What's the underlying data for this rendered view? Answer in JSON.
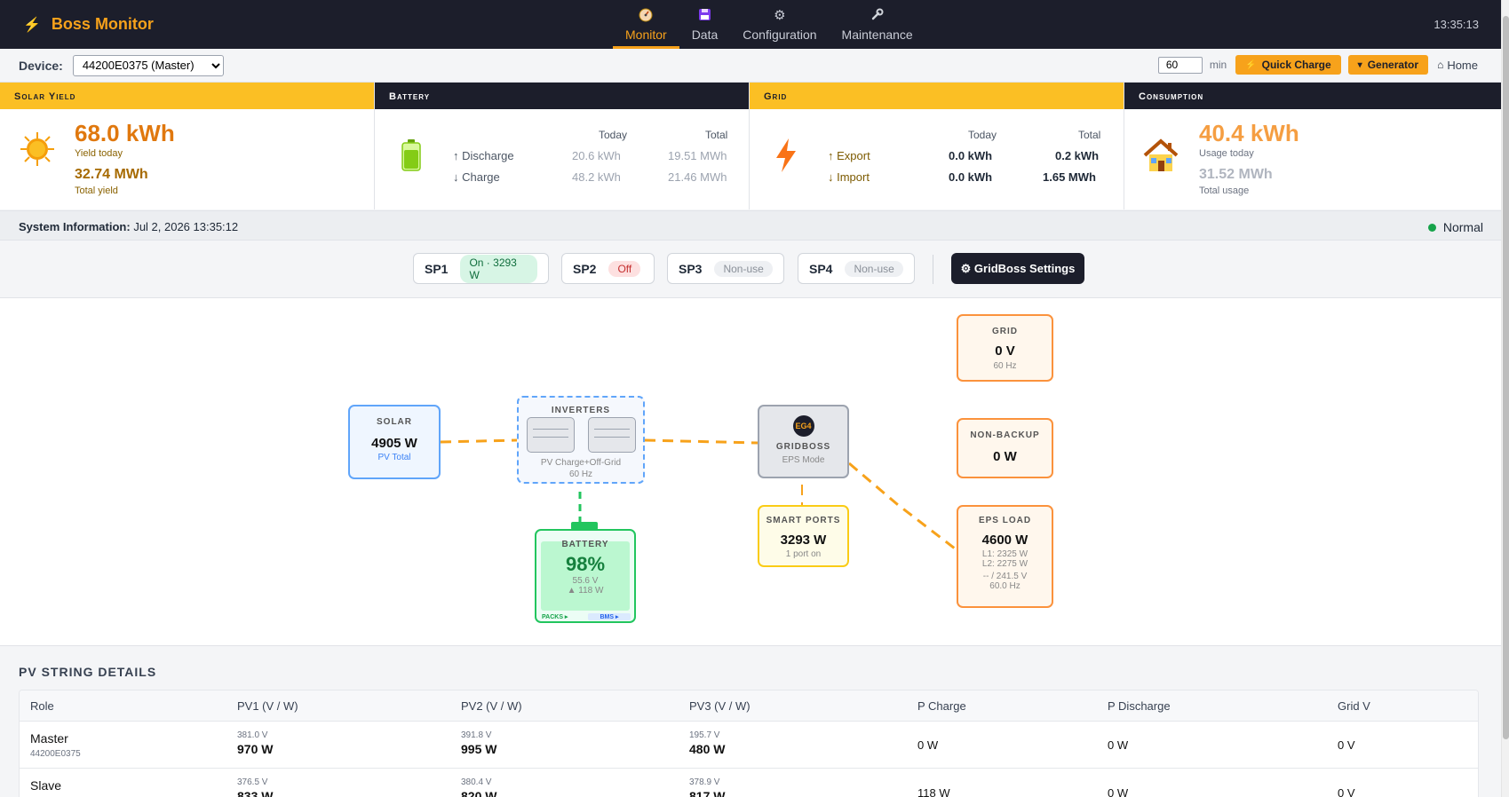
{
  "app": {
    "title": "Boss Monitor",
    "clock": "13:35:13"
  },
  "nav": [
    {
      "label": "Monitor",
      "icon": "gauge-icon"
    },
    {
      "label": "Data",
      "icon": "floppy-icon"
    },
    {
      "label": "Configuration",
      "icon": "gear-icon"
    },
    {
      "label": "Maintenance",
      "icon": "wrench-icon"
    }
  ],
  "device": {
    "label": "Device:",
    "selected": "44200E0375 (Master)",
    "minutes": "60",
    "min_unit": "min",
    "quick_charge": "Quick Charge",
    "generator": "Generator",
    "home": "Home"
  },
  "cards": {
    "solar": {
      "title": "Solar Yield",
      "today": "68.0 kWh",
      "today_label": "Yield today",
      "total": "32.74 MWh",
      "total_label": "Total yield"
    },
    "battery": {
      "title": "Battery",
      "col_today": "Today",
      "col_total": "Total",
      "rows": [
        {
          "label": "↑ Discharge",
          "today": "20.6 kWh",
          "total": "19.51 MWh"
        },
        {
          "label": "↓ Charge",
          "today": "48.2 kWh",
          "total": "21.46 MWh"
        }
      ]
    },
    "grid": {
      "title": "Grid",
      "col_today": "Today",
      "col_total": "Total",
      "rows": [
        {
          "label": "↑ Export",
          "today": "0.0 kWh",
          "total": "0.2 kWh"
        },
        {
          "label": "↓ Import",
          "today": "0.0 kWh",
          "total": "1.65 MWh"
        }
      ]
    },
    "consumption": {
      "title": "Consumption",
      "today": "40.4 kWh",
      "today_label": "Usage today",
      "total": "31.52 MWh",
      "total_label": "Total usage"
    }
  },
  "system": {
    "label": "System Information:",
    "datetime": "Jul 2, 2026 13:35:12",
    "status": "Normal"
  },
  "smart_ports": [
    {
      "name": "SP1",
      "state": "On · 3293 W"
    },
    {
      "name": "SP2",
      "state": "Off"
    },
    {
      "name": "SP3",
      "state": "Non-use"
    },
    {
      "name": "SP4",
      "state": "Non-use"
    }
  ],
  "gridboss_settings": "⚙ GridBoss Settings",
  "flow": {
    "solar": {
      "title": "SOLAR",
      "value": "4905 W",
      "sub": "PV Total"
    },
    "inverters": {
      "title": "INVERTERS",
      "mode": "PV Charge+Off-Grid",
      "freq": "60 Hz"
    },
    "gridboss": {
      "badge": "EG4",
      "title": "GRIDBOSS",
      "mode": "EPS Mode"
    },
    "grid": {
      "title": "GRID",
      "value": "0 V",
      "sub": "60 Hz"
    },
    "nonbackup": {
      "title": "NON-BACKUP",
      "value": "0 W"
    },
    "eps": {
      "title": "EPS LOAD",
      "value": "4600 W",
      "l1": "L1: 2325 W",
      "l2": "L2: 2275 W",
      "volt": "-- / 241.5 V",
      "freq": "60.0 Hz"
    },
    "smartports": {
      "title": "SMART PORTS",
      "value": "3293 W",
      "sub": "1 port on"
    },
    "battery": {
      "title": "BATTERY",
      "soc": "98%",
      "volt": "55.6 V",
      "power": "▲ 118 W",
      "packs": "PACKS ▸",
      "bms": "BMS ▸",
      "soc_fraction": 0.98
    }
  },
  "pv_table": {
    "title": "PV STRING DETAILS",
    "headers": [
      "Role",
      "PV1 (V / W)",
      "PV2 (V / W)",
      "PV3 (V / W)",
      "P Charge",
      "P Discharge",
      "Grid V"
    ],
    "rows": [
      {
        "role": "Master",
        "serial": "44200E0375",
        "pv1_v": "381.0 V",
        "pv1_w": "970 W",
        "pv2_v": "391.8 V",
        "pv2_w": "995 W",
        "pv3_v": "195.7 V",
        "pv3_w": "480 W",
        "pcharge": "0 W",
        "pdischarge": "0 W",
        "gridv": "0 V"
      },
      {
        "role": "Slave",
        "serial": "",
        "pv1_v": "376.5 V",
        "pv1_w": "833 W",
        "pv2_v": "380.4 V",
        "pv2_w": "820 W",
        "pv3_v": "378.9 V",
        "pv3_w": "817 W",
        "pcharge": "118 W",
        "pdischarge": "0 W",
        "gridv": "0 V"
      }
    ]
  },
  "colors": {
    "accent": "#f7a21b",
    "dark": "#1c1e2b",
    "solar": "#e0780e",
    "ok": "#16a34a"
  }
}
